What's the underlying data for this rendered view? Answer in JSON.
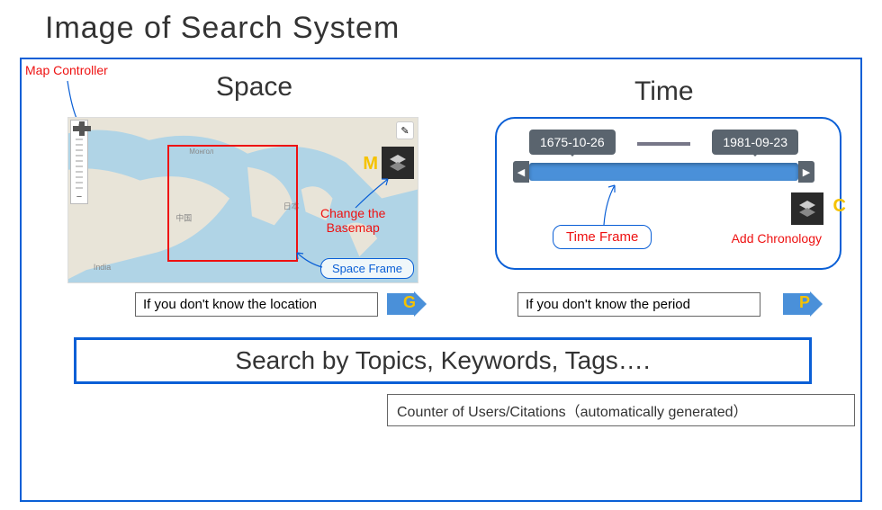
{
  "page_title": "Image of Search System",
  "annotations": {
    "map_controller": "Map Controller",
    "space_heading": "Space",
    "time_heading": "Time",
    "change_basemap_line1": "Change the",
    "change_basemap_line2": "Basemap",
    "space_frame": "Space Frame",
    "time_frame": "Time Frame",
    "add_chronology": "Add Chronology"
  },
  "time_slider": {
    "start_date": "1675-10-26",
    "end_date": "1981-09-23"
  },
  "shortcuts": {
    "m": "M",
    "g": "G",
    "p": "P",
    "c": "C"
  },
  "hints": {
    "location": "If you don't know the location",
    "period": "If you don't know the period"
  },
  "search": {
    "label": "Search by Topics, Keywords, Tags…."
  },
  "footer": {
    "counter": "Counter of Users/Citations（automatically generated）"
  },
  "map": {
    "labels": [
      "India",
      "中国",
      "日本",
      "Moнгол"
    ]
  }
}
